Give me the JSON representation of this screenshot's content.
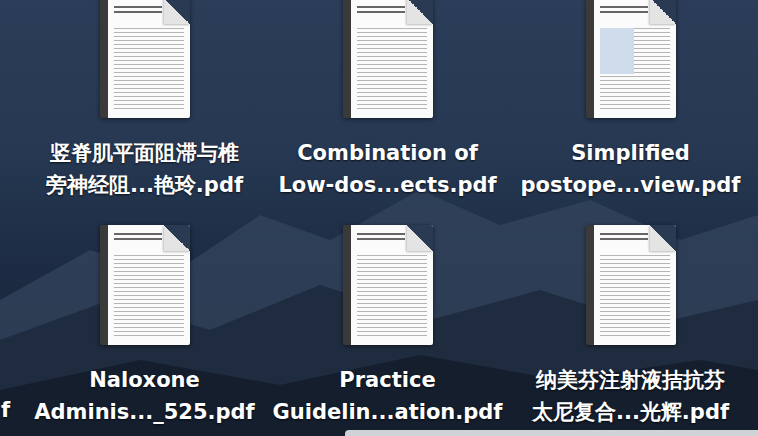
{
  "desktop": {
    "icons": [
      {
        "label_lines": [
          "竖脊肌平面阻滞与椎",
          "旁神经阻...艳玲.pdf"
        ],
        "selected": false
      },
      {
        "label_lines": [
          "Combination of",
          "Low-dos...ects.pdf"
        ],
        "selected": false
      },
      {
        "label_lines": [
          "Simplified",
          "postope...view.pdf"
        ],
        "selected": false
      },
      {
        "label_lines": [
          "Naloxone",
          "Adminis..._525.pdf"
        ],
        "selected": false
      },
      {
        "label_lines": [
          "Practice",
          "Guidelin...ation.pdf"
        ],
        "selected": false
      },
      {
        "label_lines": [
          "纳美芬注射液拮抗芬",
          "太尼复合...光辉.pdf"
        ],
        "selected": false
      }
    ],
    "edge_fragment": {
      "text": "f"
    }
  }
}
